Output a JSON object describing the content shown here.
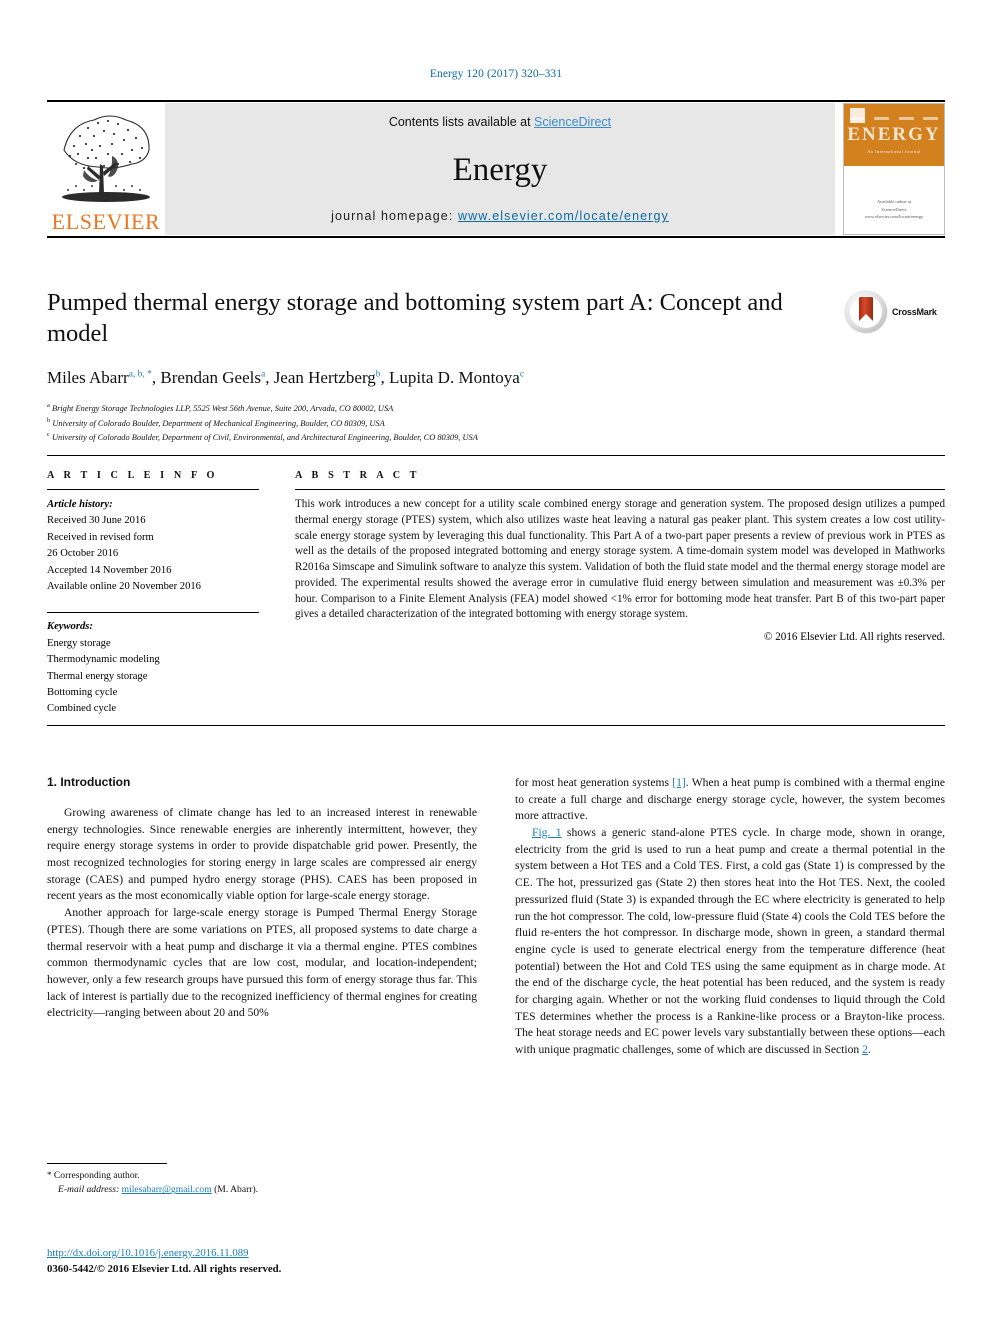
{
  "running_head": "Energy 120 (2017) 320–331",
  "masthead": {
    "contents_prefix": "Contents lists available at ",
    "sciencedirect": "ScienceDirect",
    "journal_name": "Energy",
    "homepage_prefix": "journal homepage: ",
    "homepage_url": "www.elsevier.com/locate/energy",
    "publisher_logo_text": "ELSEVIER",
    "cover": {
      "title": "ENERGY",
      "subtitle": "An International Journal",
      "bottom_text_1": "Available online at",
      "bottom_text_2": "ScienceDirect",
      "bottom_text_3": "www.elsevier.com/locate/energy"
    },
    "accent_link_color": "#3a8cc8"
  },
  "article": {
    "title": "Pumped thermal energy storage and bottoming system part A: Concept and model",
    "authors": [
      {
        "name": "Miles Abarr",
        "marks": "a, b, *"
      },
      {
        "name": "Brendan Geels",
        "marks": "a"
      },
      {
        "name": "Jean Hertzberg",
        "marks": "b"
      },
      {
        "name": "Lupita D. Montoya",
        "marks": "c"
      }
    ],
    "affiliations": [
      {
        "mark": "a",
        "text": "Bright Energy Storage Technologies LLP, 5525 West 56th Avenue, Suite 200, Arvada, CO 80002, USA"
      },
      {
        "mark": "b",
        "text": "University of Colorado Boulder, Department of Mechanical Engineering, Boulder, CO 80309, USA"
      },
      {
        "mark": "c",
        "text": "University of Colorado Boulder, Department of Civil, Environmental, and Architectural Engineering, Boulder, CO 80309, USA"
      }
    ],
    "crossmark_label": "CrossMark"
  },
  "article_info": {
    "heading": "A R T I C L E  I N F O",
    "history_label": "Article history:",
    "history": [
      "Received 30 June 2016",
      "Received in revised form",
      "26 October 2016",
      "Accepted 14 November 2016",
      "Available online 20 November 2016"
    ],
    "keywords_label": "Keywords:",
    "keywords": [
      "Energy storage",
      "Thermodynamic modeling",
      "Thermal energy storage",
      "Bottoming cycle",
      "Combined cycle"
    ]
  },
  "abstract": {
    "heading": "A B S T R A C T",
    "text": "This work introduces a new concept for a utility scale combined energy storage and generation system. The proposed design utilizes a pumped thermal energy storage (PTES) system, which also utilizes waste heat leaving a natural gas peaker plant. This system creates a low cost utility-scale energy storage system by leveraging this dual functionality. This Part A of a two-part paper presents a review of previous work in PTES as well as the details of the proposed integrated bottoming and energy storage system. A time-domain system model was developed in Mathworks R2016a Simscape and Simulink software to analyze this system. Validation of both the fluid state model and the thermal energy storage model are provided. The experimental results showed the average error in cumulative fluid energy between simulation and measurement was ±0.3% per hour. Comparison to a Finite Element Analysis (FEA) model showed <1% error for bottoming mode heat transfer. Part B of this two-part paper gives a detailed characterization of the integrated bottoming with energy storage system.",
    "copyright": "© 2016 Elsevier Ltd. All rights reserved."
  },
  "body": {
    "section_number_title": "1. Introduction",
    "left_para_1": "Growing awareness of climate change has led to an increased interest in renewable energy technologies. Since renewable energies are inherently intermittent, however, they require energy storage systems in order to provide dispatchable grid power. Presently, the most recognized technologies for storing energy in large scales are compressed air energy storage (CAES) and pumped hydro energy storage (PHS). CAES has been proposed in recent years as the most economically viable option for large-scale energy storage.",
    "left_para_2": "Another approach for large-scale energy storage is Pumped Thermal Energy Storage (PTES). Though there are some variations on PTES, all proposed systems to date charge a thermal reservoir with a heat pump and discharge it via a thermal engine. PTES combines common thermodynamic cycles that are low cost, modular, and location-independent; however, only a few research groups have pursued this form of energy storage thus far. This lack of interest is partially due to the recognized inefficiency of thermal engines for creating electricity—ranging between about 20 and 50%",
    "right_para_1_a": "for most heat generation systems ",
    "right_para_1_ref": "[1]",
    "right_para_1_b": ". When a heat pump is combined with a thermal engine to create a full charge and discharge energy storage cycle, however, the system becomes more attractive.",
    "right_para_2_ref": "Fig. 1",
    "right_para_2_a": " shows a generic stand-alone PTES cycle. In charge mode, shown in orange, electricity from the grid is used to run a heat pump and create a thermal potential in the system between a Hot TES and a Cold TES. First, a cold gas (State 1) is compressed by the CE. The hot, pressurized gas (State 2) then stores heat into the Hot TES. Next, the cooled pressurized fluid (State 3) is expanded through the EC where electricity is generated to help run the hot compressor. The cold, low-pressure fluid (State 4) cools the Cold TES before the fluid re-enters the hot compressor. In discharge mode, shown in green, a standard thermal engine cycle is used to generate electrical energy from the temperature difference (heat potential) between the Hot and Cold TES using the same equipment as in charge mode. At the end of the discharge cycle, the heat potential has been reduced, and the system is ready for charging again. Whether or not the working fluid condenses to liquid through the Cold TES determines whether the process is a Rankine-like process or a Brayton-like process. The heat storage needs and EC power levels vary substantially between these options—each with unique pragmatic challenges, some of which are discussed in Section ",
    "right_para_2_ref2": "2",
    "right_para_2_b": "."
  },
  "footnote": {
    "star": "*",
    "corresponding": " Corresponding author.",
    "email_label": "E-mail address:",
    "email": "milesabarr@gmail.com",
    "email_suffix": " (M. Abarr)."
  },
  "footer": {
    "doi": "http://dx.doi.org/10.1016/j.energy.2016.11.089",
    "issn": "0360-5442/© 2016 Elsevier Ltd. All rights reserved."
  },
  "colors": {
    "link": "#1b7eb5",
    "elsevier_orange": "#E87722",
    "cover_orange": "#d3801f",
    "band_gray": "#e7e7e7"
  }
}
